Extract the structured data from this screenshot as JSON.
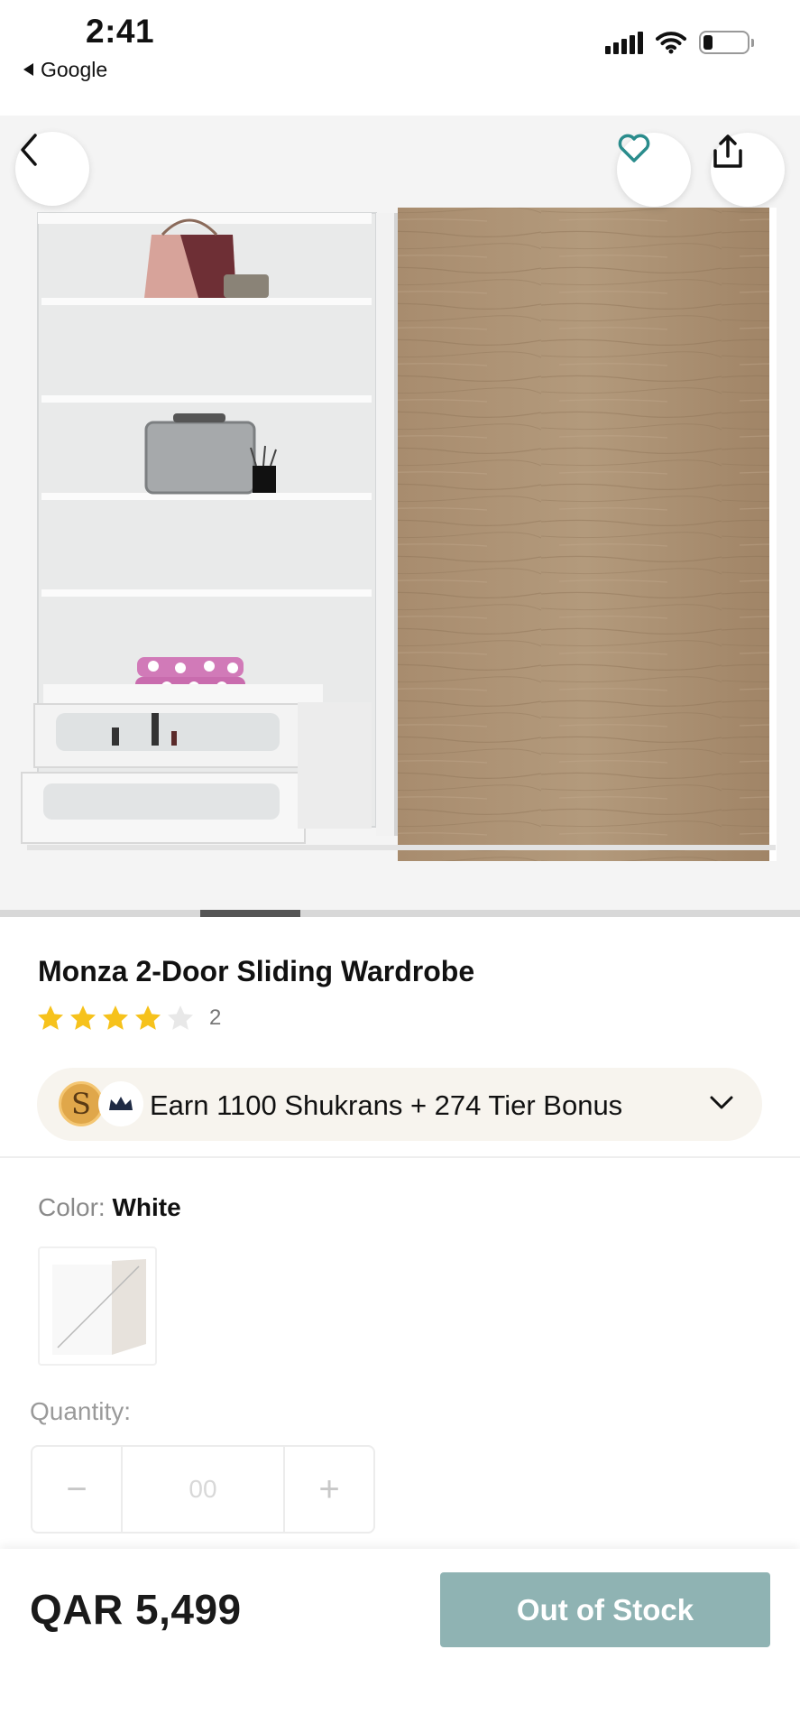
{
  "status_bar": {
    "time": "2:41",
    "back_app": "Google"
  },
  "hero": {
    "image_alt": "Monza 2-Door Sliding Wardrobe product photo",
    "carousel_position": 0.25,
    "buttons": {
      "back_icon": "chevron-left-icon",
      "favorite_icon": "heart-icon",
      "share_icon": "share-icon"
    },
    "colors": {
      "accent": "#2a8c8c"
    }
  },
  "product": {
    "title": "Monza 2-Door Sliding Wardrobe",
    "rating": 4,
    "rating_max": 5,
    "review_count": "2",
    "star_color": "#f6c21c"
  },
  "shukran": {
    "coin_letter": "S",
    "text": "Earn 1100 Shukrans + 274 Tier Bonus"
  },
  "options": {
    "color_label": "Color:",
    "color_value": "White",
    "quantity_label": "Quantity:",
    "quantity_value": "00",
    "decrement": "−",
    "increment": "+"
  },
  "footer": {
    "price": "QAR 5,499",
    "cta_label": "Out of Stock",
    "cta_color": "#8fb3b3"
  }
}
